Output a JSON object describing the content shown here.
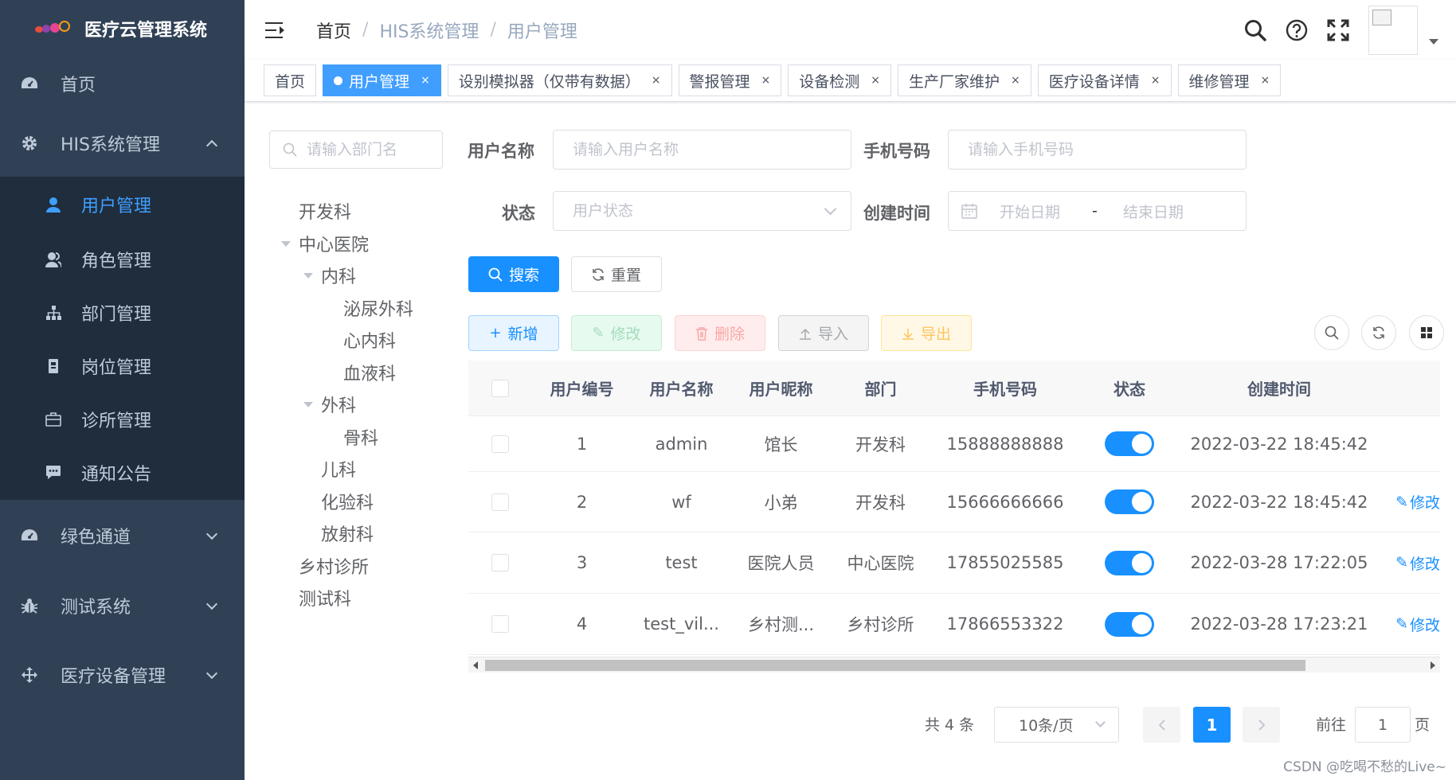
{
  "app": {
    "title": "医疗云管理系统"
  },
  "sidebar": {
    "home": "首页",
    "his": "HIS系统管理",
    "his_sub": [
      "用户管理",
      "角色管理",
      "部门管理",
      "岗位管理",
      "诊所管理",
      "通知公告"
    ],
    "green": "绿色通道",
    "test": "测试系统",
    "device": "医疗设备管理"
  },
  "breadcrumb": {
    "home": "首页",
    "level1": "HIS系统管理",
    "level2": "用户管理"
  },
  "tags": [
    "首页",
    "用户管理",
    "设别模拟器（仅带有数据）",
    "警报管理",
    "设备检测",
    "生产厂家维护",
    "医疗设备详情",
    "维修管理"
  ],
  "dept": {
    "placeholder": "请输入部门名",
    "nodes": [
      "开发科",
      "中心医院",
      "内科",
      "泌尿外科",
      "心内科",
      "血液科",
      "外科",
      "骨科",
      "儿科",
      "化验科",
      "放射科",
      "乡村诊所",
      "测试科"
    ]
  },
  "form": {
    "username_label": "用户名称",
    "username_placeholder": "请输入用户名称",
    "phone_label": "手机号码",
    "phone_placeholder": "请输入手机号码",
    "status_label": "状态",
    "status_placeholder": "用户状态",
    "created_label": "创建时间",
    "start_placeholder": "开始日期",
    "range_sep": "-",
    "end_placeholder": "结束日期",
    "search_btn": "搜索",
    "reset_btn": "重置"
  },
  "toolbar": {
    "add": "新增",
    "edit": "修改",
    "delete": "删除",
    "import": "导入",
    "export": "导出"
  },
  "table": {
    "headers": [
      "用户编号",
      "用户名称",
      "用户昵称",
      "部门",
      "手机号码",
      "状态",
      "创建时间"
    ],
    "edit_label": "修改",
    "rows": [
      {
        "id": "1",
        "name": "admin",
        "nick": "馆长",
        "dept": "开发科",
        "phone": "15888888888",
        "status": true,
        "created": "2022-03-22 18:45:42",
        "edit": false
      },
      {
        "id": "2",
        "name": "wf",
        "nick": "小弟",
        "dept": "开发科",
        "phone": "15666666666",
        "status": true,
        "created": "2022-03-22 18:45:42",
        "edit": true
      },
      {
        "id": "3",
        "name": "test",
        "nick": "医院人员",
        "dept": "中心医院",
        "phone": "17855025585",
        "status": true,
        "created": "2022-03-28 17:22:05",
        "edit": true
      },
      {
        "id": "4",
        "name": "test_vil...",
        "nick": "乡村测...",
        "dept": "乡村诊所",
        "phone": "17866553322",
        "status": true,
        "created": "2022-03-28 17:23:21",
        "edit": true
      }
    ]
  },
  "pagination": {
    "total": "共 4 条",
    "page_size": "10条/页",
    "current": "1",
    "goto": "前往",
    "goto_value": "1",
    "page_unit": "页"
  },
  "watermark": "CSDN @吃喝不愁的Live~",
  "colors": {
    "sidebar_bg": "#304156",
    "submenu_bg": "#1f2d3d",
    "primary": "#1890ff",
    "active_text": "#409eff"
  }
}
